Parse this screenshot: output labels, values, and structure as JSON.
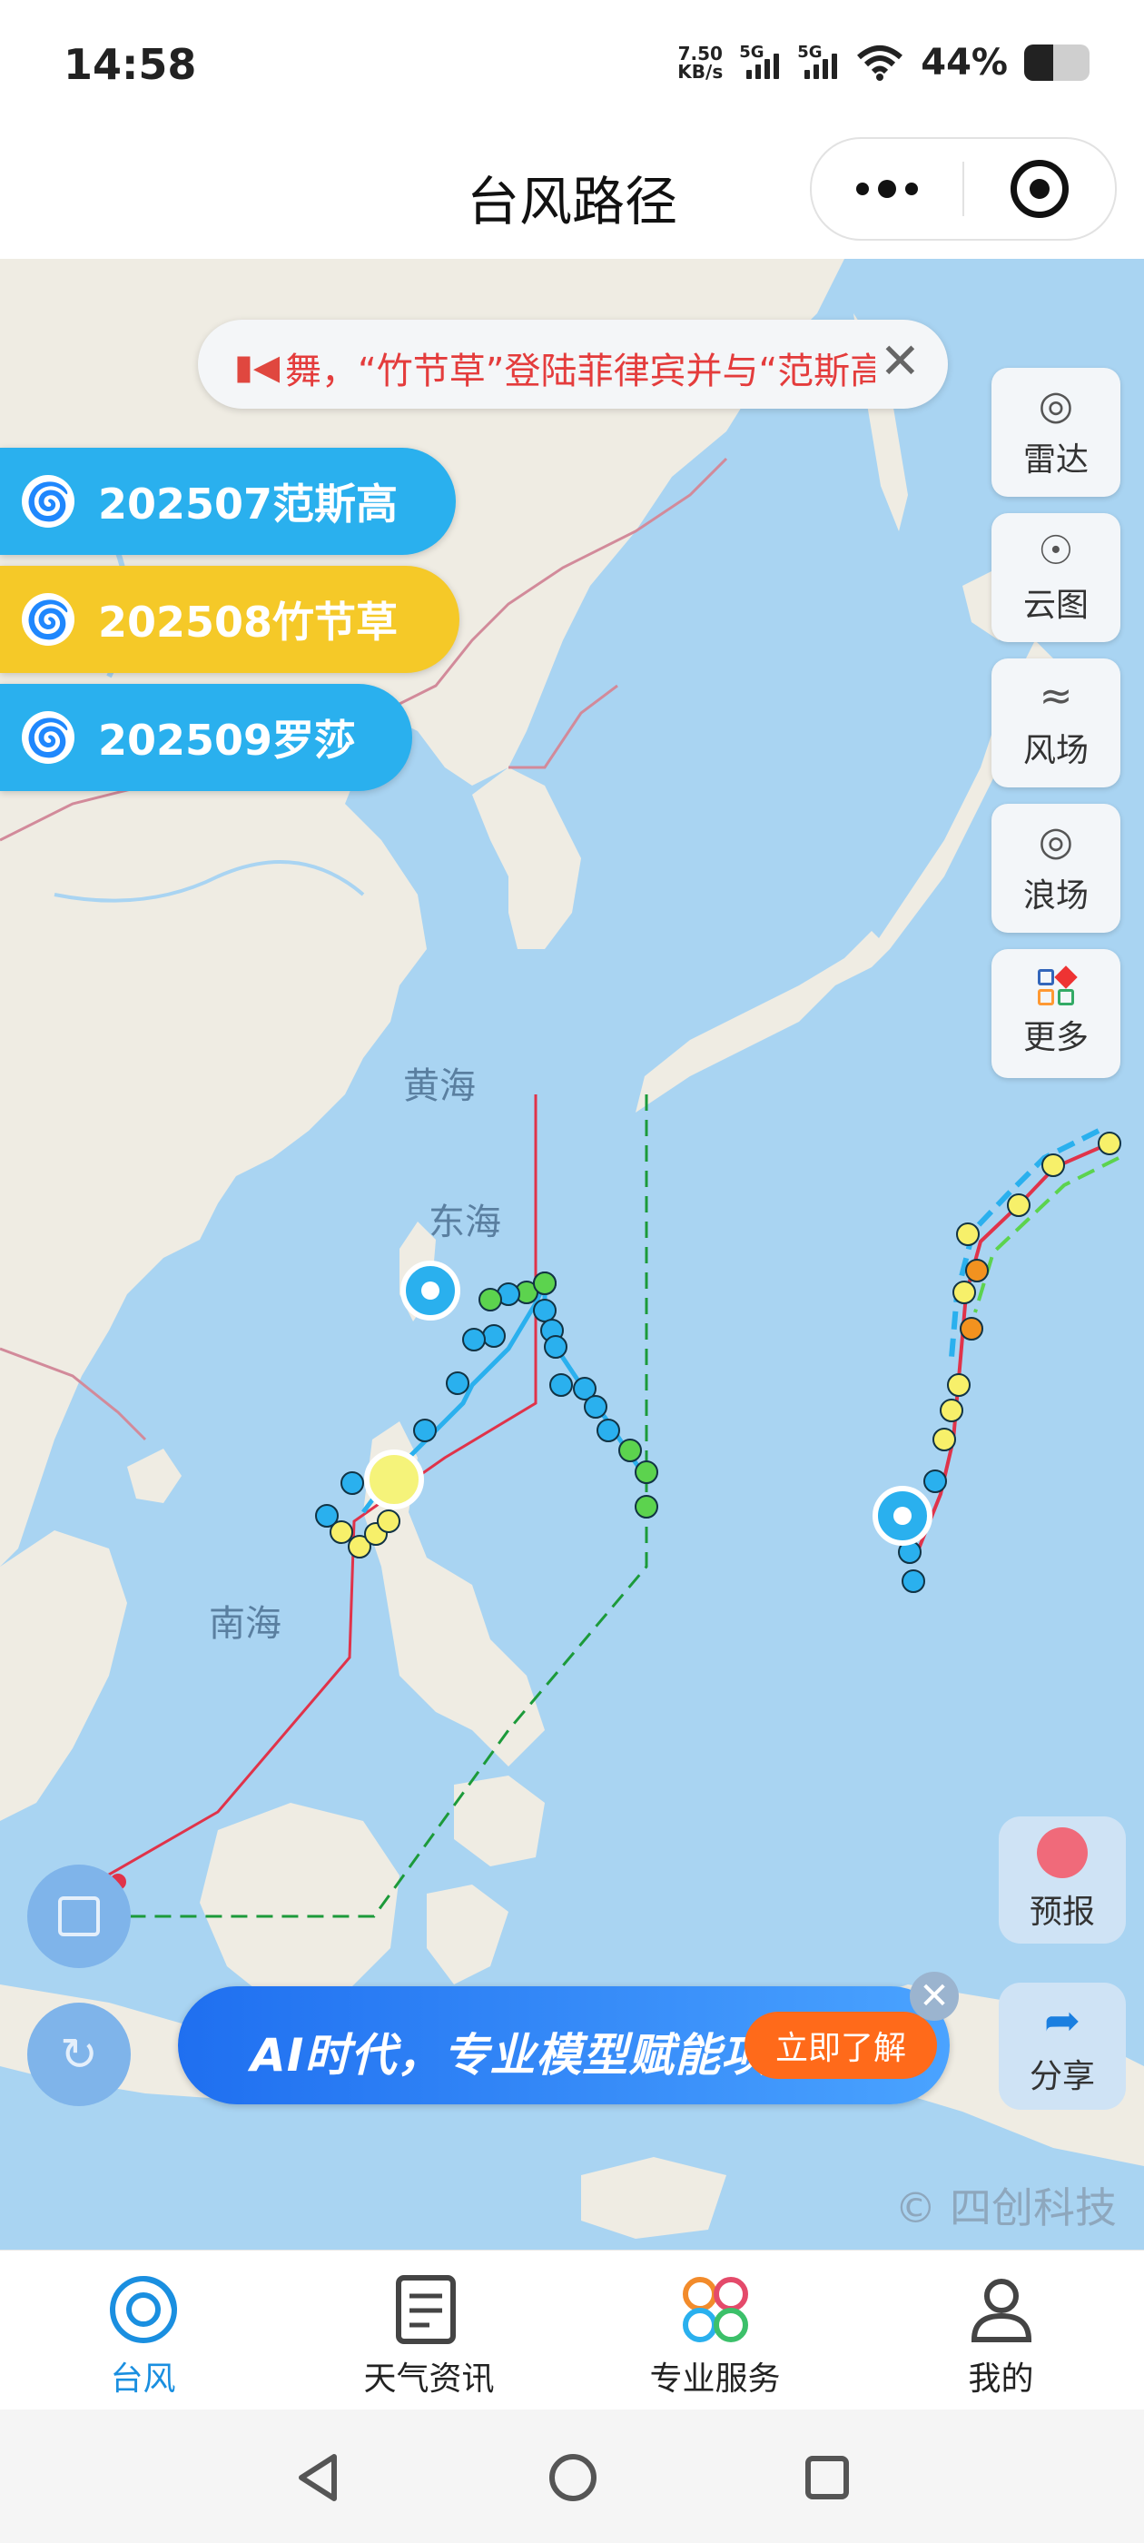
{
  "status_bar": {
    "time": "14:58",
    "net_speed_top": "7.50",
    "net_speed_unit": "KB/s",
    "signal1_label": "5G",
    "signal2_label": "5G",
    "battery_text": "44%",
    "battery_level": 0.44,
    "icons": [
      "signal-icon",
      "wifi-icon",
      "battery-icon"
    ]
  },
  "title_bar": {
    "title": "台风路径",
    "more_icon": "more-dots-icon",
    "close_icon": "target-close-icon"
  },
  "map": {
    "labels": {
      "yellow_sea": "黄海",
      "east_sea": "东海",
      "south_sea": "南海"
    },
    "notice": {
      "text": "舞，“竹节草”登陆菲律宾并与“范斯高”",
      "icon": "speaker-icon",
      "close": "✕"
    },
    "typhoons": [
      {
        "label": "202507范斯高",
        "color": "#2ab0ee"
      },
      {
        "label": "202508竹节草",
        "color": "#f5c928"
      },
      {
        "label": "202509罗莎",
        "color": "#2ab0ee"
      }
    ],
    "tools": [
      {
        "label": "雷达",
        "icon": "radar-icon"
      },
      {
        "label": "云图",
        "icon": "satellite-icon"
      },
      {
        "label": "风场",
        "icon": "wind-icon"
      },
      {
        "label": "浪场",
        "icon": "wave-icon"
      },
      {
        "label": "更多",
        "icon": "grid-more-icon"
      }
    ],
    "forecast_label": "预报",
    "share_label": "分享",
    "banner": {
      "text": "AI时代，专业模型赋能项目",
      "button": "立即了解"
    },
    "watermark": "© 四创科技"
  },
  "tab_bar": {
    "tabs": [
      {
        "label": "台风",
        "icon": "typhoon-icon",
        "active": true
      },
      {
        "label": "天气资讯",
        "icon": "news-icon",
        "active": false
      },
      {
        "label": "专业服务",
        "icon": "services-icon",
        "active": false
      },
      {
        "label": "我的",
        "icon": "user-icon",
        "active": false
      }
    ]
  },
  "nav_bar": {
    "icons": [
      "back-icon",
      "home-icon",
      "recents-icon"
    ]
  },
  "colors": {
    "accent": "#1a8fe0",
    "sea": "#a9d4f2",
    "land": "#efece3",
    "typhoon_blue": "#2ab0ee",
    "typhoon_yellow": "#f5c928"
  }
}
